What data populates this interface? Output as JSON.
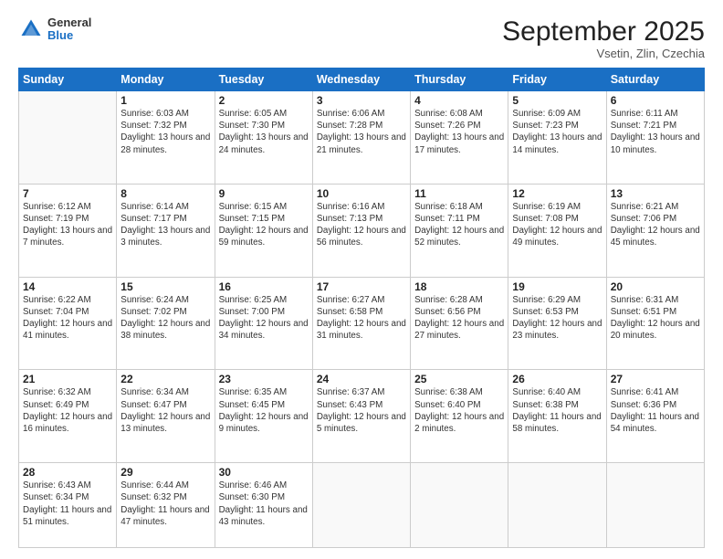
{
  "header": {
    "logo": {
      "general": "General",
      "blue": "Blue"
    },
    "title": "September 2025",
    "subtitle": "Vsetin, Zlin, Czechia"
  },
  "weekdays": [
    "Sunday",
    "Monday",
    "Tuesday",
    "Wednesday",
    "Thursday",
    "Friday",
    "Saturday"
  ],
  "weeks": [
    [
      {
        "day": null,
        "info": null
      },
      {
        "day": "1",
        "info": "Sunrise: 6:03 AM\nSunset: 7:32 PM\nDaylight: 13 hours and 28 minutes."
      },
      {
        "day": "2",
        "info": "Sunrise: 6:05 AM\nSunset: 7:30 PM\nDaylight: 13 hours and 24 minutes."
      },
      {
        "day": "3",
        "info": "Sunrise: 6:06 AM\nSunset: 7:28 PM\nDaylight: 13 hours and 21 minutes."
      },
      {
        "day": "4",
        "info": "Sunrise: 6:08 AM\nSunset: 7:26 PM\nDaylight: 13 hours and 17 minutes."
      },
      {
        "day": "5",
        "info": "Sunrise: 6:09 AM\nSunset: 7:23 PM\nDaylight: 13 hours and 14 minutes."
      },
      {
        "day": "6",
        "info": "Sunrise: 6:11 AM\nSunset: 7:21 PM\nDaylight: 13 hours and 10 minutes."
      }
    ],
    [
      {
        "day": "7",
        "info": "Sunrise: 6:12 AM\nSunset: 7:19 PM\nDaylight: 13 hours and 7 minutes."
      },
      {
        "day": "8",
        "info": "Sunrise: 6:14 AM\nSunset: 7:17 PM\nDaylight: 13 hours and 3 minutes."
      },
      {
        "day": "9",
        "info": "Sunrise: 6:15 AM\nSunset: 7:15 PM\nDaylight: 12 hours and 59 minutes."
      },
      {
        "day": "10",
        "info": "Sunrise: 6:16 AM\nSunset: 7:13 PM\nDaylight: 12 hours and 56 minutes."
      },
      {
        "day": "11",
        "info": "Sunrise: 6:18 AM\nSunset: 7:11 PM\nDaylight: 12 hours and 52 minutes."
      },
      {
        "day": "12",
        "info": "Sunrise: 6:19 AM\nSunset: 7:08 PM\nDaylight: 12 hours and 49 minutes."
      },
      {
        "day": "13",
        "info": "Sunrise: 6:21 AM\nSunset: 7:06 PM\nDaylight: 12 hours and 45 minutes."
      }
    ],
    [
      {
        "day": "14",
        "info": "Sunrise: 6:22 AM\nSunset: 7:04 PM\nDaylight: 12 hours and 41 minutes."
      },
      {
        "day": "15",
        "info": "Sunrise: 6:24 AM\nSunset: 7:02 PM\nDaylight: 12 hours and 38 minutes."
      },
      {
        "day": "16",
        "info": "Sunrise: 6:25 AM\nSunset: 7:00 PM\nDaylight: 12 hours and 34 minutes."
      },
      {
        "day": "17",
        "info": "Sunrise: 6:27 AM\nSunset: 6:58 PM\nDaylight: 12 hours and 31 minutes."
      },
      {
        "day": "18",
        "info": "Sunrise: 6:28 AM\nSunset: 6:56 PM\nDaylight: 12 hours and 27 minutes."
      },
      {
        "day": "19",
        "info": "Sunrise: 6:29 AM\nSunset: 6:53 PM\nDaylight: 12 hours and 23 minutes."
      },
      {
        "day": "20",
        "info": "Sunrise: 6:31 AM\nSunset: 6:51 PM\nDaylight: 12 hours and 20 minutes."
      }
    ],
    [
      {
        "day": "21",
        "info": "Sunrise: 6:32 AM\nSunset: 6:49 PM\nDaylight: 12 hours and 16 minutes."
      },
      {
        "day": "22",
        "info": "Sunrise: 6:34 AM\nSunset: 6:47 PM\nDaylight: 12 hours and 13 minutes."
      },
      {
        "day": "23",
        "info": "Sunrise: 6:35 AM\nSunset: 6:45 PM\nDaylight: 12 hours and 9 minutes."
      },
      {
        "day": "24",
        "info": "Sunrise: 6:37 AM\nSunset: 6:43 PM\nDaylight: 12 hours and 5 minutes."
      },
      {
        "day": "25",
        "info": "Sunrise: 6:38 AM\nSunset: 6:40 PM\nDaylight: 12 hours and 2 minutes."
      },
      {
        "day": "26",
        "info": "Sunrise: 6:40 AM\nSunset: 6:38 PM\nDaylight: 11 hours and 58 minutes."
      },
      {
        "day": "27",
        "info": "Sunrise: 6:41 AM\nSunset: 6:36 PM\nDaylight: 11 hours and 54 minutes."
      }
    ],
    [
      {
        "day": "28",
        "info": "Sunrise: 6:43 AM\nSunset: 6:34 PM\nDaylight: 11 hours and 51 minutes."
      },
      {
        "day": "29",
        "info": "Sunrise: 6:44 AM\nSunset: 6:32 PM\nDaylight: 11 hours and 47 minutes."
      },
      {
        "day": "30",
        "info": "Sunrise: 6:46 AM\nSunset: 6:30 PM\nDaylight: 11 hours and 43 minutes."
      },
      {
        "day": null,
        "info": null
      },
      {
        "day": null,
        "info": null
      },
      {
        "day": null,
        "info": null
      },
      {
        "day": null,
        "info": null
      }
    ]
  ]
}
